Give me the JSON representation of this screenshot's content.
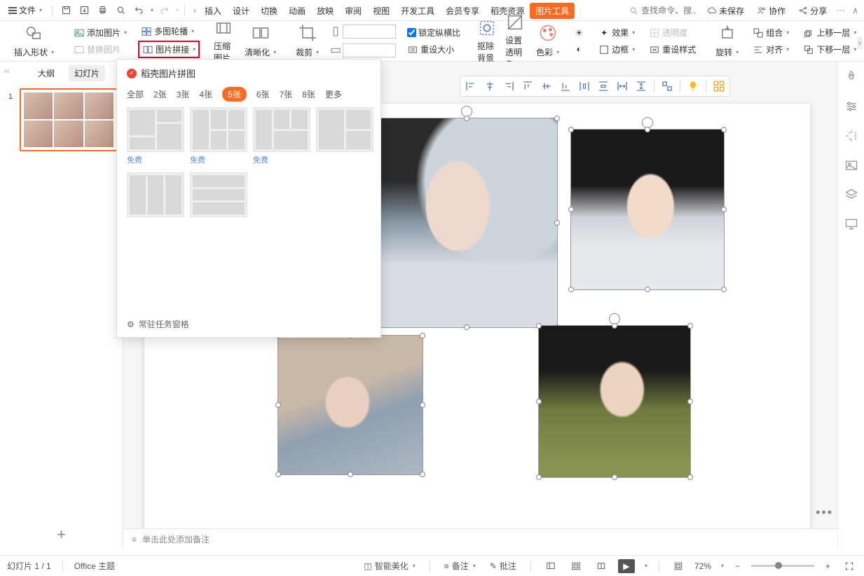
{
  "menu": {
    "file": "文件"
  },
  "tabs": [
    "插入",
    "设计",
    "切换",
    "动画",
    "放映",
    "审阅",
    "视图",
    "开发工具",
    "会员专享",
    "稻壳资源"
  ],
  "contextTab": "图片工具",
  "search": {
    "placeholder": "查找命令、搜..."
  },
  "titleRight": {
    "unsaved": "未保存",
    "collab": "协作",
    "share": "分享"
  },
  "ribbon": {
    "insertShape": "插入形状",
    "addImage": "添加图片",
    "multiCarousel": "多图轮播",
    "replaceImage": "替换图片",
    "imageStitch": "图片拼接",
    "compress": "压缩图片",
    "sharpen": "清晰化",
    "crop": "裁剪",
    "lockRatio": "锁定纵横比",
    "resetSize": "重设大小",
    "removeBg": "抠除背景",
    "setTransColor": "设置透明色",
    "color": "色彩",
    "effects": "效果",
    "transparency": "透明度",
    "border": "边框",
    "resetStyle": "重设样式",
    "rotate": "旋转",
    "group": "组合",
    "align": "对齐",
    "moveUp": "上移一层",
    "moveDown": "下移一层"
  },
  "leftPane": {
    "collapse": "‹‹",
    "outlineTab": "大纲",
    "slideTab": "幻灯片",
    "slideNum": "1"
  },
  "dropdown": {
    "title": "稻壳图片拼图",
    "tabs": {
      "all": "全部",
      "t2": "2张",
      "t3": "3张",
      "t4": "4张",
      "t5": "5张",
      "t6": "6张",
      "t7": "7张",
      "t8": "8张",
      "more": "更多"
    },
    "free": "免费",
    "footer": "常驻任务窗格"
  },
  "notes": {
    "placeholder": "单击此处添加备注"
  },
  "statusbar": {
    "slideInfo": "幻灯片 1 / 1",
    "theme": "Office 主题",
    "beautify": "智能美化",
    "notes": "备注",
    "comments": "批注",
    "zoom": "72%"
  }
}
